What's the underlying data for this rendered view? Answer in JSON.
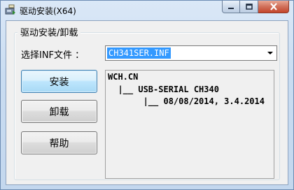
{
  "window": {
    "title": "驱动安装(X64)"
  },
  "group": {
    "title": "驱动安装/卸载"
  },
  "inf": {
    "label": "选择INF文件 ：",
    "selected": "CH341SER.INF"
  },
  "buttons": {
    "install": "安装",
    "uninstall": "卸载",
    "help": "帮助"
  },
  "info": {
    "vendor": "WCH.CN",
    "device": "  |__ USB-SERIAL CH340",
    "version": "       |__ 08/08/2014, 3.4.2014"
  },
  "icons": {
    "app": "driver-install-icon",
    "minimize": "minimize-icon",
    "maximize": "maximize-icon",
    "close": "close-icon",
    "dropdown": "chevron-down-icon"
  },
  "colors": {
    "selection": "#3399ff",
    "close_button": "#c4442a"
  }
}
